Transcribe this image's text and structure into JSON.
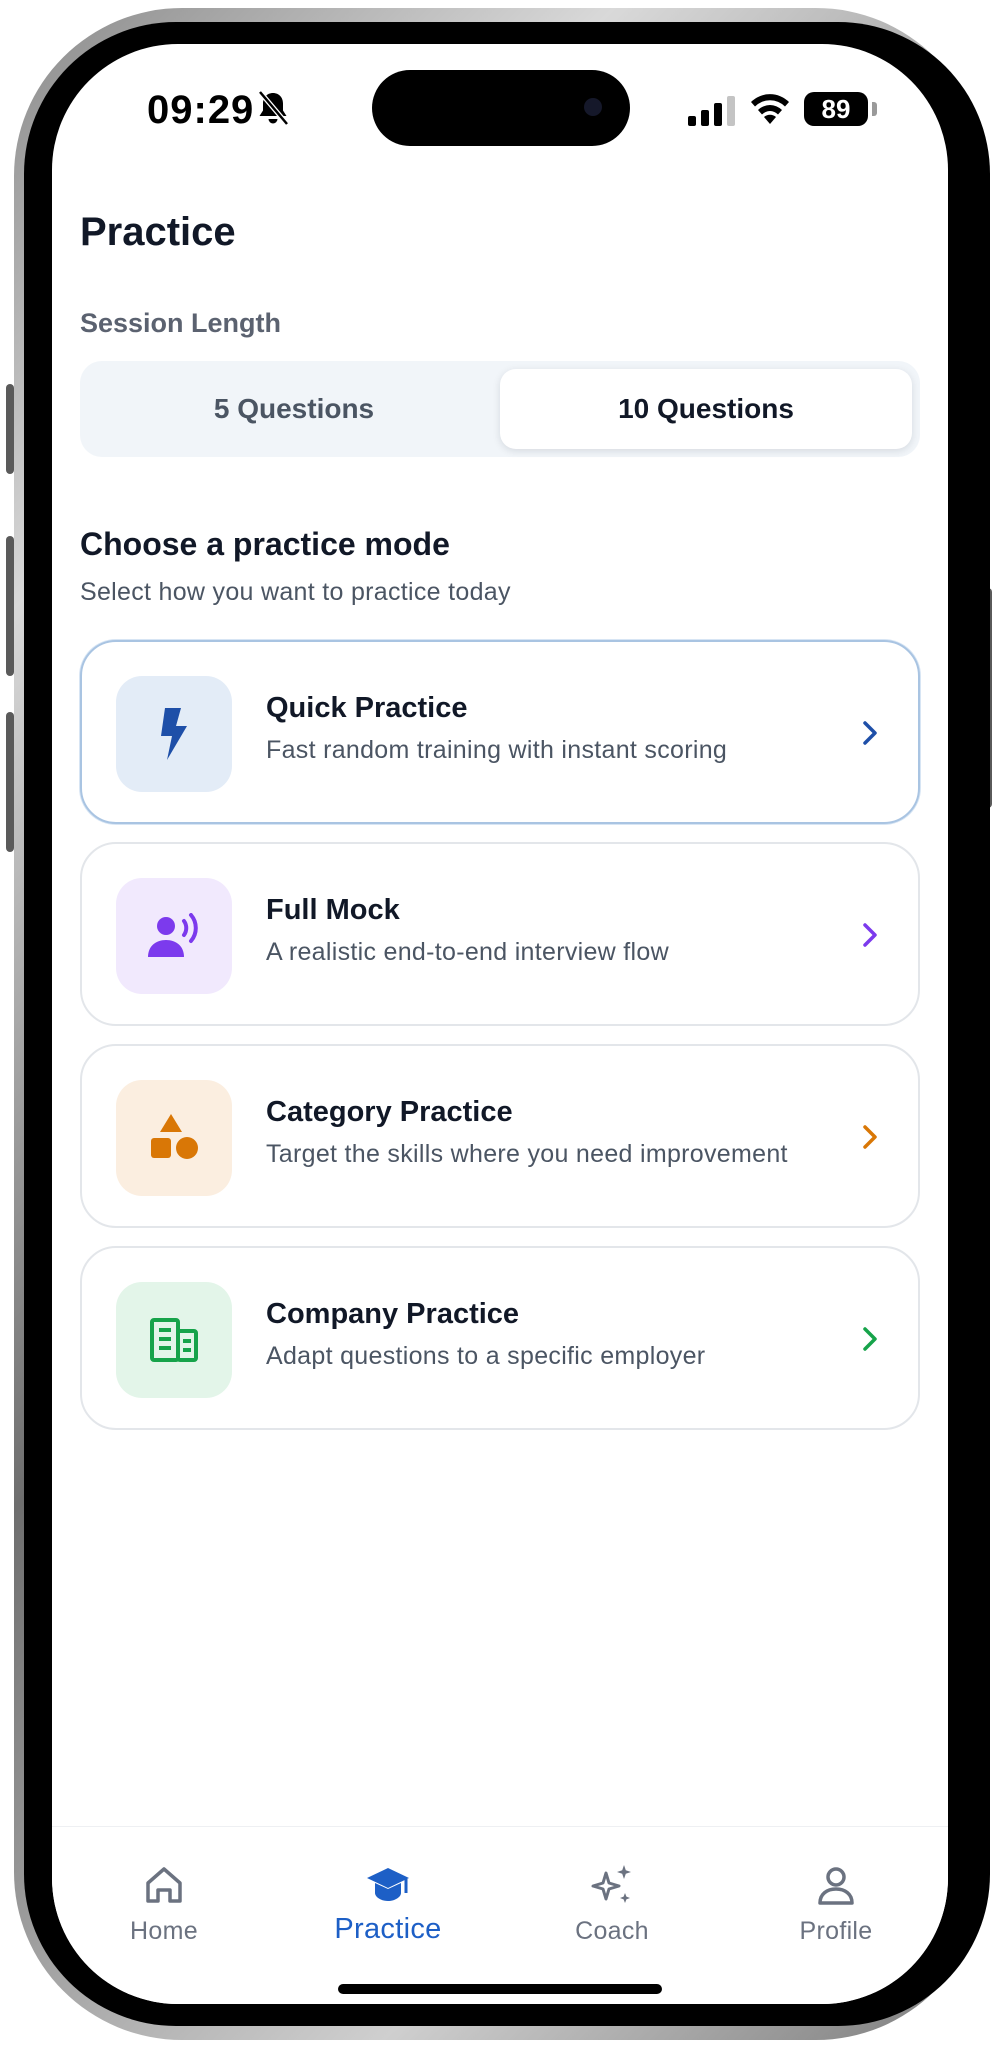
{
  "status_bar": {
    "time": "09:29",
    "battery": "89",
    "icons": [
      "bell-slash-icon",
      "signal-icon",
      "wifi-icon",
      "battery-icon"
    ]
  },
  "header": {
    "title": "Practice"
  },
  "session": {
    "label": "Session Length",
    "options": [
      {
        "label": "5 Questions",
        "selected": false
      },
      {
        "label": "10 Questions",
        "selected": true
      }
    ]
  },
  "modes": {
    "title": "Choose a practice mode",
    "subtitle": "Select how you want to practice today",
    "items": [
      {
        "title": "Quick Practice",
        "description": "Fast random training with instant scoring",
        "icon": "bolt-icon",
        "accent": "#1e4fa8",
        "tint": "#e3ecf7",
        "selected": true
      },
      {
        "title": "Full Mock",
        "description": "A realistic end-to-end interview flow",
        "icon": "person-voice-icon",
        "accent": "#7c3aed",
        "tint": "#f1e9fd",
        "selected": false
      },
      {
        "title": "Category Practice",
        "description": "Target the skills where you need improvement",
        "icon": "shapes-icon",
        "accent": "#d97706",
        "tint": "#fbeee0",
        "selected": false
      },
      {
        "title": "Company Practice",
        "description": "Adapt questions to a specific employer",
        "icon": "building-icon",
        "accent": "#16a34a",
        "tint": "#e3f5e9",
        "selected": false
      }
    ]
  },
  "tab_bar": {
    "active_color": "#1d5fc6",
    "items": [
      {
        "label": "Home",
        "icon": "home-icon"
      },
      {
        "label": "Practice",
        "icon": "graduation-cap-icon",
        "active": true
      },
      {
        "label": "Coach",
        "icon": "sparkles-icon"
      },
      {
        "label": "Profile",
        "icon": "person-icon"
      }
    ]
  }
}
